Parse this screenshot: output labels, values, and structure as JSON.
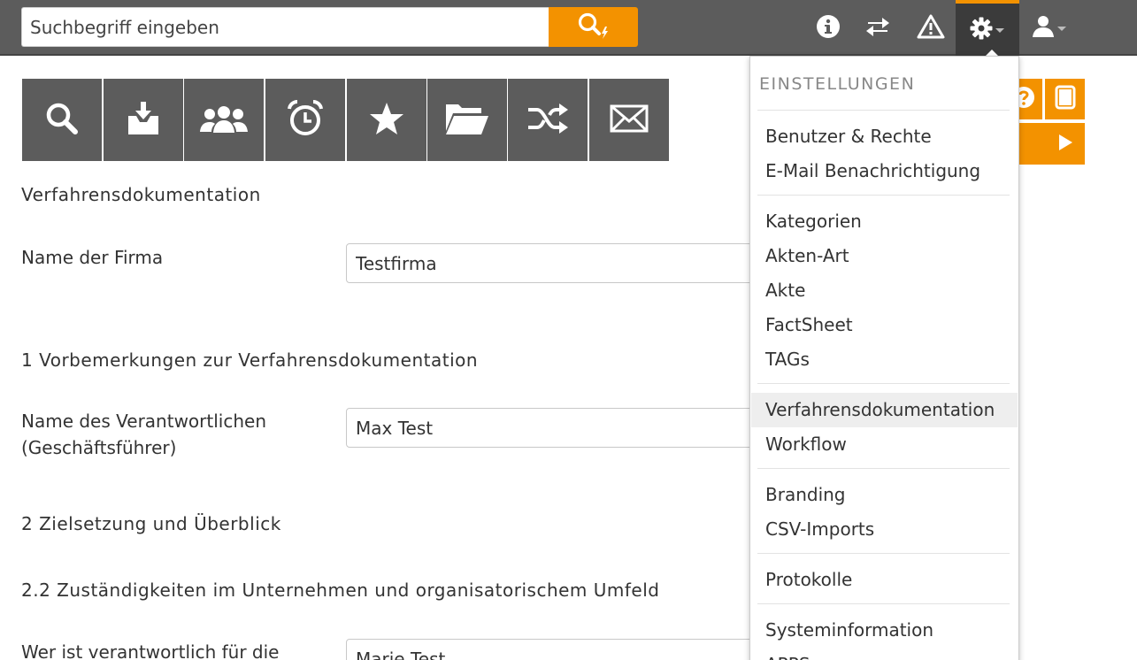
{
  "search": {
    "placeholder": "Suchbegriff eingeben"
  },
  "topbar": {
    "icons": [
      "search-bolt-icon",
      "info-icon",
      "exchange-icon",
      "warning-icon",
      "gear-icon",
      "user-icon"
    ]
  },
  "tiles": [
    "search-icon",
    "inbox-download-icon",
    "users-icon",
    "alarm-clock-icon",
    "star-icon",
    "folder-open-icon",
    "shuffle-icon",
    "envelope-icon"
  ],
  "content": {
    "section_title": "Verfahrensdokumentation",
    "company_label": "Name der Firma",
    "company_value": "Testfirma",
    "section1": "1 Vorbemerkungen zur Verfahrensdokumentation",
    "responsible_label_1": "Name des Verantwortlichen",
    "responsible_label_2": "(Geschäftsführer)",
    "responsible_value": "Max Test",
    "section2": "2 Zielsetzung und Überblick",
    "section22": "2.2 Zuständigkeiten im Unternehmen und organisatorischem Umfeld",
    "who_label": "Wer ist verantwortlich für die",
    "who_value": "Marie Test"
  },
  "dropdown": {
    "header": "EINSTELLUNGEN",
    "items": [
      "Benutzer & Rechte",
      "E-Mail Benachrichtigung",
      "Kategorien",
      "Akten-Art",
      "Akte",
      "FactSheet",
      "TAGs",
      "Verfahrensdokumentation",
      "Workflow",
      "Branding",
      "CSV-Imports",
      "Protokolle",
      "Systeminformation",
      "APPS"
    ]
  },
  "colors": {
    "accent": "#f39200",
    "bar": "#5c5c5c",
    "bar_active": "#3b3b3b"
  }
}
